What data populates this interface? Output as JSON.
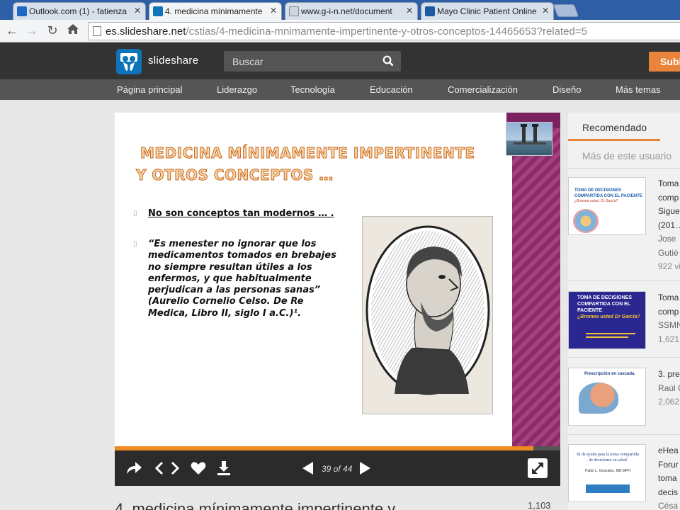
{
  "browser": {
    "tabs": [
      {
        "label": "Outlook.com (1) - fatienza",
        "active": false
      },
      {
        "label": "4. medicina mínimamente",
        "active": true
      },
      {
        "label": "www.g-i-n.net/document",
        "active": false
      },
      {
        "label": "Mayo Clinic Patient Online",
        "active": false
      }
    ],
    "url_host": "es.slideshare.net",
    "url_path": "/cstias/4-medicina-mnimamente-impertinente-y-otros-conceptos-14465653?related=5"
  },
  "header": {
    "brand": "slideshare",
    "search_placeholder": "Buscar",
    "upload_label": "Subir",
    "categories": [
      "Página principal",
      "Liderazgo",
      "Tecnología",
      "Educación",
      "Comercialización",
      "Diseño",
      "Más temas"
    ]
  },
  "slide": {
    "title_line1": "MEDICINA MÍNIMAMENTE IMPERTINENTE",
    "title_line2": "Y OTROS CONCEPTOS …",
    "bullet1": "No son conceptos tan modernos … .",
    "quote": "“Es menester no ignorar que los medicamentos tomados en brebajes no siempre resultan útiles a los enfermos, y que habitualmente perjudican a las personas sanas” (Aurelio Cornelio Celso. De Re Medica, Libro II, siglo I a.C.)¹.",
    "progress_fraction": 0.94
  },
  "player": {
    "page_indicator": "39 of 44"
  },
  "below": {
    "title": "4. medicina mínimamente impertinente y",
    "views": "1,103"
  },
  "sidebar": {
    "tab_recommended": "Recomendado",
    "tab_more": "Más de este usuario",
    "items": [
      {
        "title_lines": [
          "Toma",
          "comp",
          "Sigue",
          "(201…"
        ],
        "author_lines": [
          "Jose",
          "Gutié"
        ],
        "views": "922 vi",
        "thumb_title": "TOMA DE DECISIONES COMPARTIDA CON EL PACIENTE",
        "thumb_sub": "¿Bromea usted, Dr García?"
      },
      {
        "title_lines": [
          "Toma",
          "comp"
        ],
        "author_lines": [
          "SSMN"
        ],
        "views": "1,621",
        "thumb_title": "TOMA DE DECISIONES COMPARTIDA CON EL PACIENTE",
        "thumb_sub": "¿Bromea usted Dr Garcia?"
      },
      {
        "title_lines": [
          "3. pre"
        ],
        "author_lines": [
          "Raúl C"
        ],
        "views": "2,062",
        "thumb_title": "Prescripción en cascada.",
        "thumb_sub": ""
      },
      {
        "title_lines": [
          "eHea",
          "Forur",
          "toma",
          "decis"
        ],
        "author_lines": [
          "Césa"
        ],
        "views": "",
        "thumb_title": "SI de ayuda para la toma compartida de decisiones en salud",
        "thumb_sub": "Pablo L. González, MD MPH"
      }
    ]
  },
  "colors": {
    "slideshare_blue": "#0e74b9",
    "accent_orange": "#e9843b",
    "chrome_blue": "#2d5ea6"
  }
}
